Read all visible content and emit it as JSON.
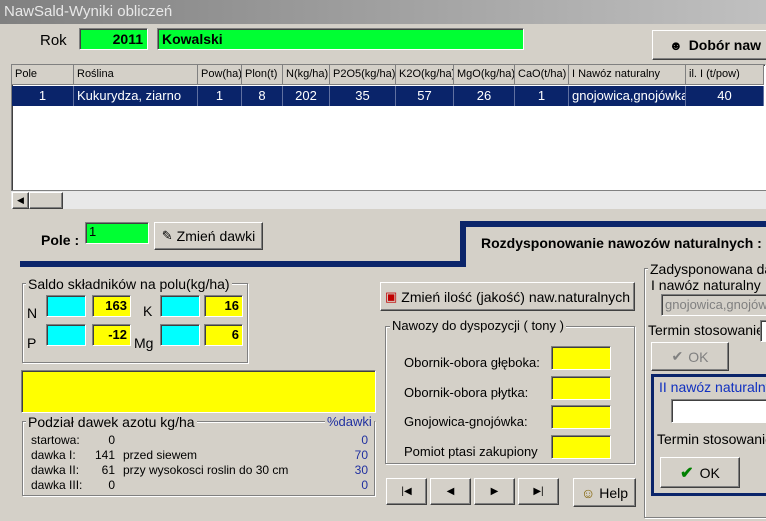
{
  "window": {
    "title": "NawSald-Wyniki obliczeń"
  },
  "header": {
    "rok_label": "Rok",
    "rok_value": "2011",
    "name_value": "Kowalski",
    "dobor_button": "Dobór naw"
  },
  "table": {
    "columns": [
      "Pole",
      "Roślina",
      "Pow(ha)",
      "Plon(t)",
      "N(kg/ha)",
      "P2O5(kg/ha)",
      "K2O(kg/ha)",
      "MgO(kg/ha)",
      "CaO(t/ha)",
      "I Nawóz naturalny",
      "il. I (t/pow)"
    ],
    "row": [
      "1",
      "Kukurydza, ziarno",
      "1",
      "8",
      "202",
      "35",
      "57",
      "26",
      "1",
      "gnojowica,gnojówka",
      "40"
    ]
  },
  "pole": {
    "label": "Pole :",
    "value": "1",
    "zmien_dawki": "Zmień dawki"
  },
  "rozdysponowanie": {
    "title": "Rozdysponowanie nawozów naturalnych :"
  },
  "saldo": {
    "title": "Saldo składników na polu(kg/ha)",
    "n_label": "N",
    "n_value": "163",
    "k_label": "K",
    "k_value": "16",
    "p_label": "P",
    "p_value": "-12",
    "mg_label": "Mg",
    "mg_value": "6"
  },
  "podzial": {
    "title": "Podział dawek azotu kg/ha",
    "pct_title": "%dawki",
    "rows": [
      {
        "label": "startowa:",
        "value": "0",
        "desc": "",
        "pct": "0"
      },
      {
        "label": "dawka I:",
        "value": "141",
        "desc": "przed siewem",
        "pct": "70"
      },
      {
        "label": "dawka II:",
        "value": "61",
        "desc": "przy wysokosci roslin do 30 cm",
        "pct": "30"
      },
      {
        "label": "dawka III:",
        "value": "0",
        "desc": "",
        "pct": "0"
      }
    ]
  },
  "zmien_ilosc_button": "Zmień ilość (jakość) naw.naturalnych",
  "nawozy": {
    "title": "Nawozy do dyspozycji ( tony )",
    "items": [
      "Obornik-obora głęboka:",
      "Obornik-obora płytka:",
      "Gnojowica-gnojówka:",
      "Pomiot ptasi zakupiony"
    ]
  },
  "nav": {
    "first": "|◀",
    "prev": "◀",
    "next": "▶",
    "last": "▶|",
    "help": "Help"
  },
  "zadysponowana": {
    "title": "Zadysponowana da",
    "i_nawoz_label": "I nawóz naturalny",
    "i_nawoz_value": "gnojowica,gnojów",
    "termin_label": "Termin stosowanie",
    "ok_label": "OK",
    "ii_nawoz_label": "II nawóz naturalny",
    "termin2_label": "Termin stosowanie",
    "ok2_label": "OK"
  }
}
